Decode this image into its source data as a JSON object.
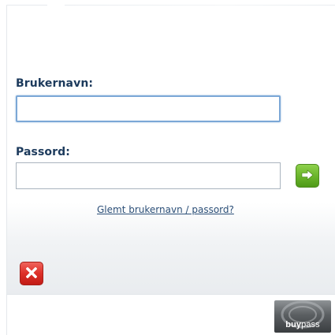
{
  "form": {
    "username_label": "Brukernavn:",
    "username_value": "",
    "password_label": "Passord:",
    "password_value": "",
    "forgot_link": "Glemt brukernavn / passord?"
  },
  "buttons": {
    "submit_icon": "arrow-right-icon",
    "close_icon": "close-x-icon",
    "submit_color": "#6cb62d",
    "close_color": "#dd2f28"
  },
  "branding": {
    "logo_bold": "buy",
    "logo_rest": "pass"
  },
  "colors": {
    "label": "#1c3a5c",
    "link": "#2c4f78",
    "focus_border": "#7ba7d6"
  }
}
